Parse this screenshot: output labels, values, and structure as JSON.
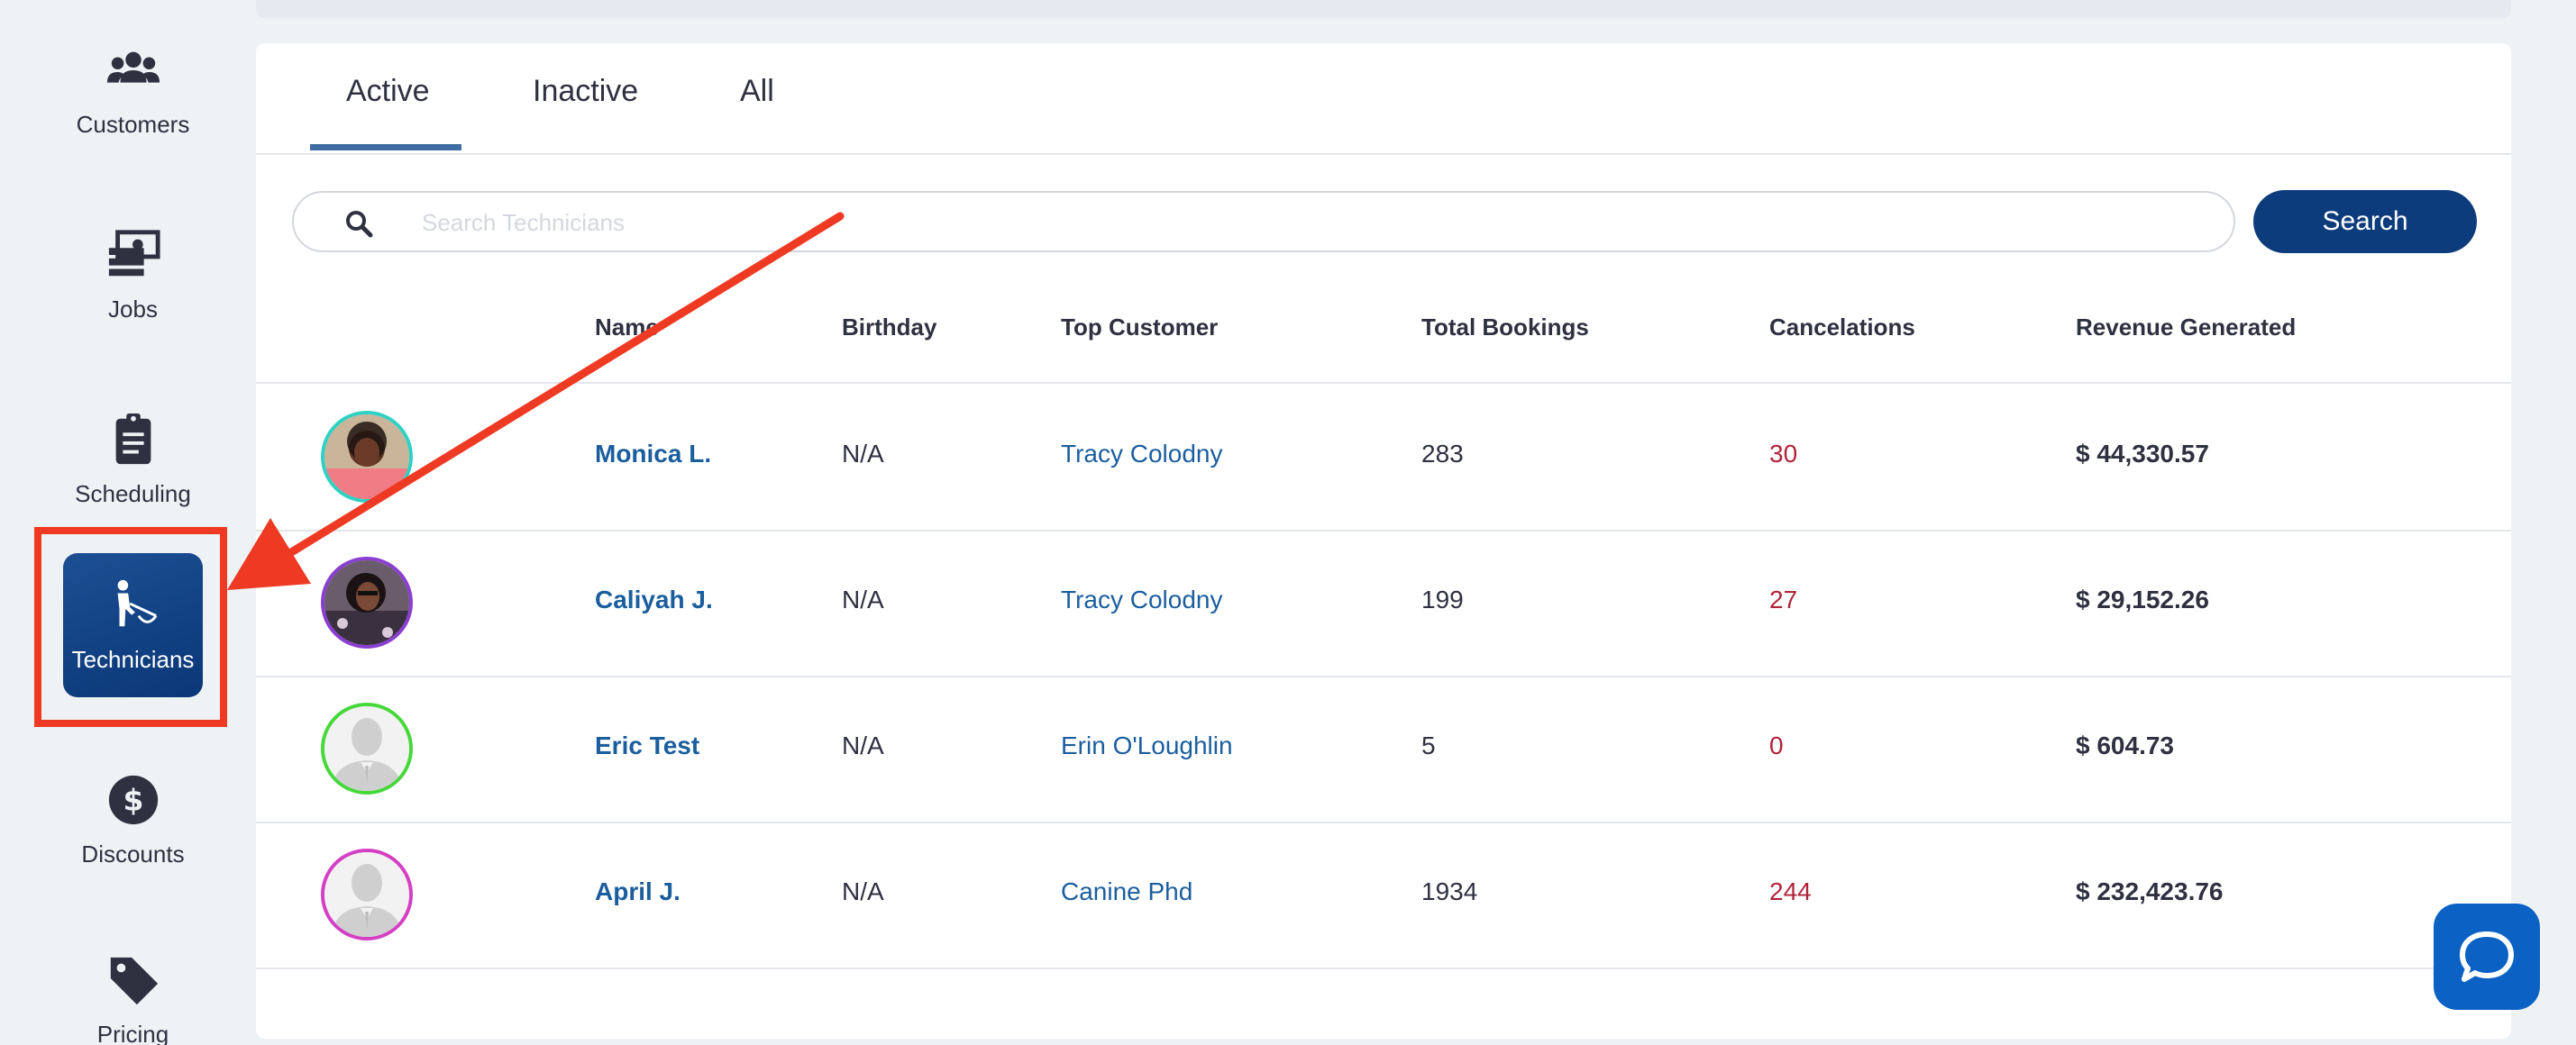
{
  "sidebar": {
    "items": [
      {
        "label": "Customers",
        "icon": "users-icon"
      },
      {
        "label": "Jobs",
        "icon": "money-stack-icon"
      },
      {
        "label": "Scheduling",
        "icon": "clipboard-icon"
      },
      {
        "label": "Technicians",
        "icon": "technician-icon",
        "active": true
      },
      {
        "label": "Discounts",
        "icon": "dollar-circle-icon"
      },
      {
        "label": "Pricing",
        "icon": "price-tag-icon"
      }
    ]
  },
  "tabs": [
    {
      "label": "Active",
      "active": true
    },
    {
      "label": "Inactive"
    },
    {
      "label": "All"
    }
  ],
  "search": {
    "placeholder": "Search Technicians",
    "button_label": "Search"
  },
  "table": {
    "headers": [
      "Name",
      "Birthday",
      "Top Customer",
      "Total Bookings",
      "Cancelations",
      "Revenue Generated"
    ],
    "rows": [
      {
        "name": "Monica L.",
        "birthday": "N/A",
        "top_customer": "Tracy Colodny",
        "total_bookings": "283",
        "cancelations": "30",
        "revenue": "$ 44,330.57",
        "ring_color": "#2ed1c3",
        "avatar": "photo"
      },
      {
        "name": "Caliyah J.",
        "birthday": "N/A",
        "top_customer": "Tracy Colodny",
        "total_bookings": "199",
        "cancelations": "27",
        "revenue": "$ 29,152.26",
        "ring_color": "#8a3fd1",
        "avatar": "photo"
      },
      {
        "name": "Eric Test",
        "birthday": "N/A",
        "top_customer": "Erin O'Loughlin",
        "total_bookings": "5",
        "cancelations": "0",
        "revenue": "$ 604.73",
        "ring_color": "#46d83a",
        "avatar": "placeholder"
      },
      {
        "name": "April J.",
        "birthday": "N/A",
        "top_customer": "Canine Phd",
        "total_bookings": "1934",
        "cancelations": "244",
        "revenue": "$ 232,423.76",
        "ring_color": "#d43fc4",
        "avatar": "placeholder"
      }
    ]
  },
  "colors": {
    "accent": "#0d3c7c",
    "link": "#1b5e9e",
    "cancel": "#b0243a",
    "annotation": "#ee3a23",
    "chat": "#0b62c4"
  }
}
